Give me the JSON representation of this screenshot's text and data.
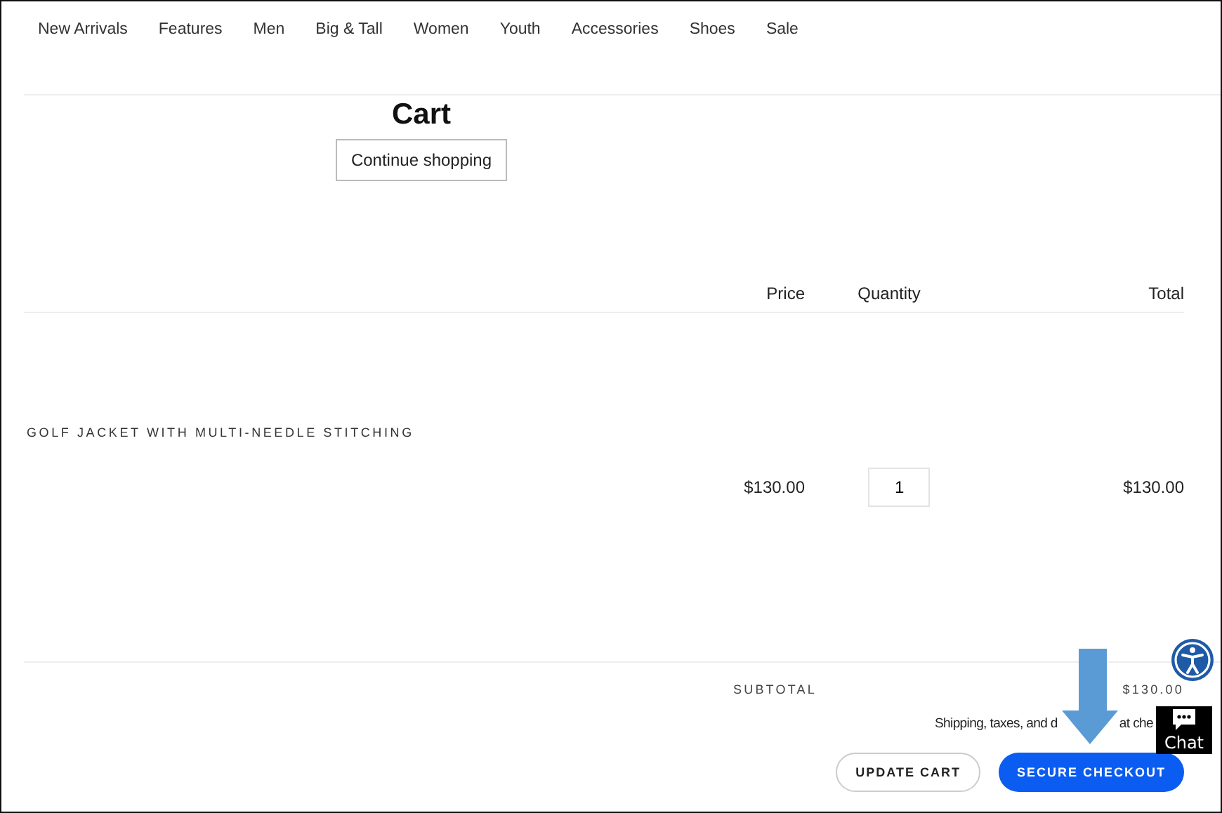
{
  "nav": [
    "New Arrivals",
    "Features",
    "Men",
    "Big & Tall",
    "Women",
    "Youth",
    "Accessories",
    "Shoes",
    "Sale"
  ],
  "title": "Cart",
  "continue_button": "Continue shopping",
  "table": {
    "columns": [
      "Price",
      "Quantity",
      "Total"
    ],
    "rows": [
      {
        "product": "GOLF JACKET WITH MULTI-NEEDLE STITCHING",
        "price": "$130.00",
        "quantity": "1",
        "total": "$130.00"
      }
    ]
  },
  "subtotal": {
    "label": "SUBTOTAL",
    "value": "$130.00"
  },
  "shipping_note": [
    "Shipping, taxes, and d",
    "at che"
  ],
  "buttons": [
    "UPDATE CART",
    "SECURE CHECKOUT"
  ],
  "chat": {
    "label": "Chat"
  }
}
